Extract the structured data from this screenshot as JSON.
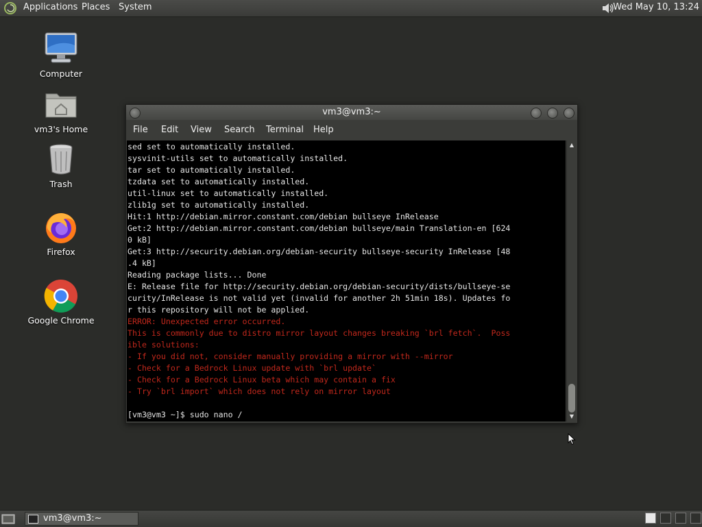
{
  "top_panel": {
    "menus": [
      "Applications",
      "Places",
      "System"
    ],
    "clock": "Wed May 10, 13:24"
  },
  "desktop_icons": [
    {
      "label": "Computer",
      "icon": "computer-icon"
    },
    {
      "label": "vm3's Home",
      "icon": "home-folder-icon"
    },
    {
      "label": "Trash",
      "icon": "trash-icon"
    },
    {
      "label": "Firefox",
      "icon": "firefox-icon"
    },
    {
      "label": "Google Chrome",
      "icon": "chrome-icon"
    }
  ],
  "window": {
    "title": "vm3@vm3:~",
    "menu": [
      "File",
      "Edit",
      "View",
      "Search",
      "Terminal",
      "Help"
    ],
    "terminal_lines": [
      {
        "text": "sed set to automatically installed.",
        "style": "normal"
      },
      {
        "text": "sysvinit-utils set to automatically installed.",
        "style": "normal"
      },
      {
        "text": "tar set to automatically installed.",
        "style": "normal"
      },
      {
        "text": "tzdata set to automatically installed.",
        "style": "normal"
      },
      {
        "text": "util-linux set to automatically installed.",
        "style": "normal"
      },
      {
        "text": "zlib1g set to automatically installed.",
        "style": "normal"
      },
      {
        "text": "Hit:1 http://debian.mirror.constant.com/debian bullseye InRelease",
        "style": "normal"
      },
      {
        "text": "Get:2 http://debian.mirror.constant.com/debian bullseye/main Translation-en [624",
        "style": "normal"
      },
      {
        "text": "0 kB]",
        "style": "normal"
      },
      {
        "text": "Get:3 http://security.debian.org/debian-security bullseye-security InRelease [48",
        "style": "normal"
      },
      {
        "text": ".4 kB]",
        "style": "normal"
      },
      {
        "text": "Reading package lists... Done",
        "style": "normal"
      },
      {
        "text": "E: Release file for http://security.debian.org/debian-security/dists/bullseye-se",
        "style": "normal"
      },
      {
        "text": "curity/InRelease is not valid yet (invalid for another 2h 51min 18s). Updates fo",
        "style": "normal"
      },
      {
        "text": "r this repository will not be applied.",
        "style": "normal"
      },
      {
        "text": "ERROR: Unexpected error occurred.",
        "style": "error"
      },
      {
        "text": "This is commonly due to distro mirror layout changes breaking `brl fetch`.  Poss",
        "style": "error"
      },
      {
        "text": "ible solutions:",
        "style": "error"
      },
      {
        "text": "- If you did not, consider manually providing a mirror with --mirror",
        "style": "error"
      },
      {
        "text": "- Check for a Bedrock Linux update with `brl update`",
        "style": "error"
      },
      {
        "text": "- Check for a Bedrock Linux beta which may contain a fix",
        "style": "error"
      },
      {
        "text": "- Try `brl import` which does not rely on mirror layout",
        "style": "error"
      },
      {
        "text": "",
        "style": "normal"
      },
      {
        "text": "[vm3@vm3 ~]$ sudo nano /",
        "style": "normal"
      }
    ]
  },
  "taskbar": {
    "task_label": "vm3@vm3:~"
  },
  "colors": {
    "desktop_bg": "#2b2c29",
    "terminal_bg": "#000000",
    "terminal_fg": "#e6e6e6",
    "error_fg": "#c2281c"
  }
}
